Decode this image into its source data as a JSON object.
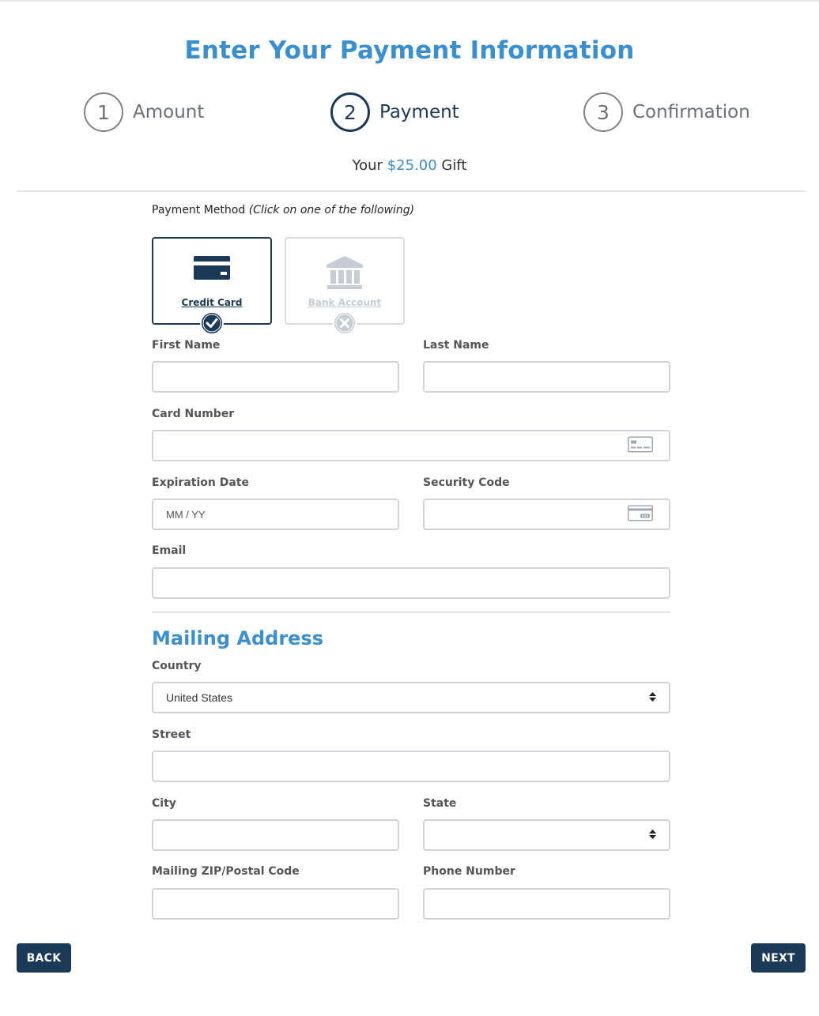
{
  "title": "Enter Your Payment Information",
  "steps": [
    {
      "number": "1",
      "label": "Amount",
      "active": false
    },
    {
      "number": "2",
      "label": "Payment",
      "active": true
    },
    {
      "number": "3",
      "label": "Confirmation",
      "active": false
    }
  ],
  "gift": {
    "prefix": "Your",
    "amount": "$25.00",
    "suffix": "Gift"
  },
  "payment_method": {
    "label": "Payment Method",
    "hint": "(Click on one of the following)",
    "options": [
      {
        "name": "Credit Card",
        "icon": "credit-card-icon",
        "selected": true,
        "badge": "checkmark-icon"
      },
      {
        "name": "Bank Account",
        "icon": "bank-icon",
        "selected": false,
        "badge": "close-icon"
      }
    ]
  },
  "fields": {
    "first_name": {
      "label": "First Name",
      "value": ""
    },
    "last_name": {
      "label": "Last Name",
      "value": ""
    },
    "card_number": {
      "label": "Card Number",
      "value": "",
      "icon": "card-front-icon"
    },
    "expiration_date": {
      "label": "Expiration Date",
      "placeholder": "MM / YY"
    },
    "security_code": {
      "label": "Security Code",
      "value": "",
      "icon": "card-back-icon"
    },
    "email": {
      "label": "Email",
      "value": ""
    }
  },
  "mailing_address": {
    "title": "Mailing Address",
    "country": {
      "label": "Country",
      "value": "United States"
    },
    "street": {
      "label": "Street",
      "value": ""
    },
    "city": {
      "label": "City",
      "value": ""
    },
    "state": {
      "label": "State",
      "value": ""
    },
    "zip": {
      "label": "Mailing ZIP/Postal Code",
      "value": ""
    },
    "phone": {
      "label": "Phone Number",
      "value": ""
    }
  },
  "buttons": {
    "back": "BACK",
    "next": "NEXT"
  },
  "colors": {
    "accent": "#3a8fd0",
    "navy": "#1b3a57",
    "border": "#d0d3d7",
    "disabled": "#c6cdd5"
  }
}
